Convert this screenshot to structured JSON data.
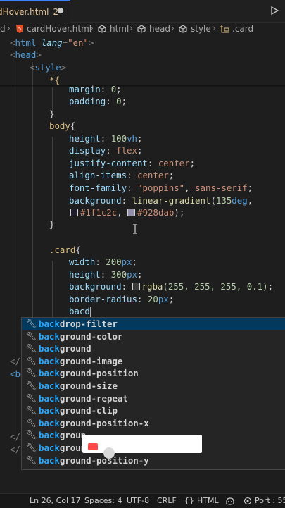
{
  "tab": {
    "name": "dHover.html",
    "modified_count": "2"
  },
  "breadcrumb": {
    "b0": "d",
    "b1": "cardHover.html",
    "b2": "html",
    "b3": "head",
    "b4": "style",
    "b5": ".card"
  },
  "code": {
    "l1": {
      "lt": "<",
      "tag": "html",
      "attr": "lang",
      "eq": "=",
      "val": "\"en\"",
      "gt": ">"
    },
    "l2": {
      "lt": "<",
      "tag": "head",
      "gt": ">"
    },
    "l3": {
      "lt": "<",
      "tag": "style",
      "gt": ">"
    },
    "l4": "*{",
    "l5": {
      "prop": "margin",
      "val": "0",
      "semi": ";"
    },
    "l6": {
      "prop": "padding",
      "val": "0",
      "semi": ";"
    },
    "l7": "}",
    "l8": {
      "sel": "body",
      "brace": "{"
    },
    "l9": {
      "prop": "height",
      "val": "100",
      "unit": "vh",
      "semi": ";"
    },
    "l10": {
      "prop": "display",
      "val": "flex",
      "semi": ";"
    },
    "l11": {
      "prop": "justify-content",
      "val": "center",
      "semi": ";"
    },
    "l12": {
      "prop": "align-items",
      "val": "center",
      "semi": ";"
    },
    "l13": {
      "prop": "font-family",
      "val": "\"poppins\"",
      "comma": ",",
      "val2": "sans-serif",
      "semi": ";"
    },
    "l14": {
      "prop": "background",
      "fn": "linear-gradient",
      "open": "(",
      "deg": "135",
      "unit": "deg",
      "comma": ","
    },
    "l15": {
      "c1": "#1f1c2c",
      "comma": ",",
      "c2": "#928dab",
      "close": ")",
      "semi": ";"
    },
    "l16": "}",
    "l17": {
      "sel": ".card",
      "brace": "{"
    },
    "l18": {
      "prop": "width",
      "val": "200",
      "unit": "px",
      "semi": ";"
    },
    "l19": {
      "prop": "height",
      "val": "300",
      "unit": "px",
      "semi": ";"
    },
    "l20": {
      "prop": "background",
      "fn": "rgba",
      "args": "(255, 255, 255, 0.1)",
      "semi": ";"
    },
    "l21": {
      "prop": "border-radius",
      "val": "20",
      "unit": "px",
      "semi": ";"
    },
    "l22": "bacd",
    "h1": "</h",
    "h2": "<bo",
    "h3": "</h",
    "h4": "</h"
  },
  "colors": {
    "swatch1": "#1f1c2c",
    "swatch2": "#928dab",
    "swatch3": "#ffffff"
  },
  "suggestions": [
    {
      "match": "back",
      "rest": "drop-filter"
    },
    {
      "match": "back",
      "rest": "ground-color"
    },
    {
      "match": "back",
      "rest": "ground"
    },
    {
      "match": "back",
      "rest": "ground-image"
    },
    {
      "match": "back",
      "rest": "ground-position"
    },
    {
      "match": "back",
      "rest": "ground-size"
    },
    {
      "match": "back",
      "rest": "ground-repeat"
    },
    {
      "match": "back",
      "rest": "ground-clip"
    },
    {
      "match": "back",
      "rest": "ground-position-x"
    },
    {
      "match": "back",
      "rest": "groun"
    },
    {
      "match": "back",
      "rest": "groun"
    },
    {
      "match": "back",
      "rest": "ground-position-y"
    }
  ],
  "status": {
    "position": "Ln 26, Col 17",
    "spaces": "Spaces: 4",
    "encoding": "UTF-8",
    "eol": "CRLF",
    "braces": "{}",
    "language": "HTML",
    "port": "Port : 55"
  }
}
